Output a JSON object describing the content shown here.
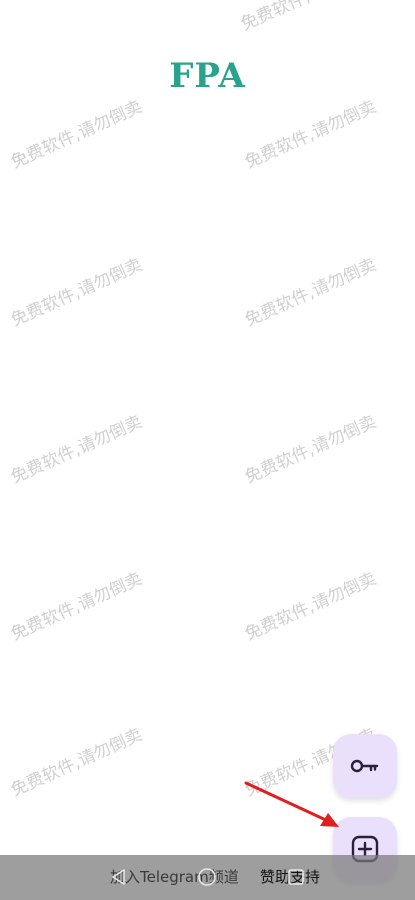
{
  "app": {
    "title": "FPA"
  },
  "watermark": {
    "text": "免费软件,请勿倒卖"
  },
  "fab": {
    "key_icon": "key-icon",
    "add_icon": "plus-square-icon"
  },
  "bottom_bar": {
    "join_link": "加入Telegram频道",
    "donate_link": "赞助支持"
  },
  "nav": {
    "back_icon": "back-triangle-icon",
    "home_icon": "home-circle-icon",
    "recents_icon": "recents-square-icon"
  },
  "colors": {
    "title": "#2aa38c",
    "fab_background": "#ebe0fb",
    "fab_icon": "#2a1f3d",
    "arrow": "#e02020"
  }
}
